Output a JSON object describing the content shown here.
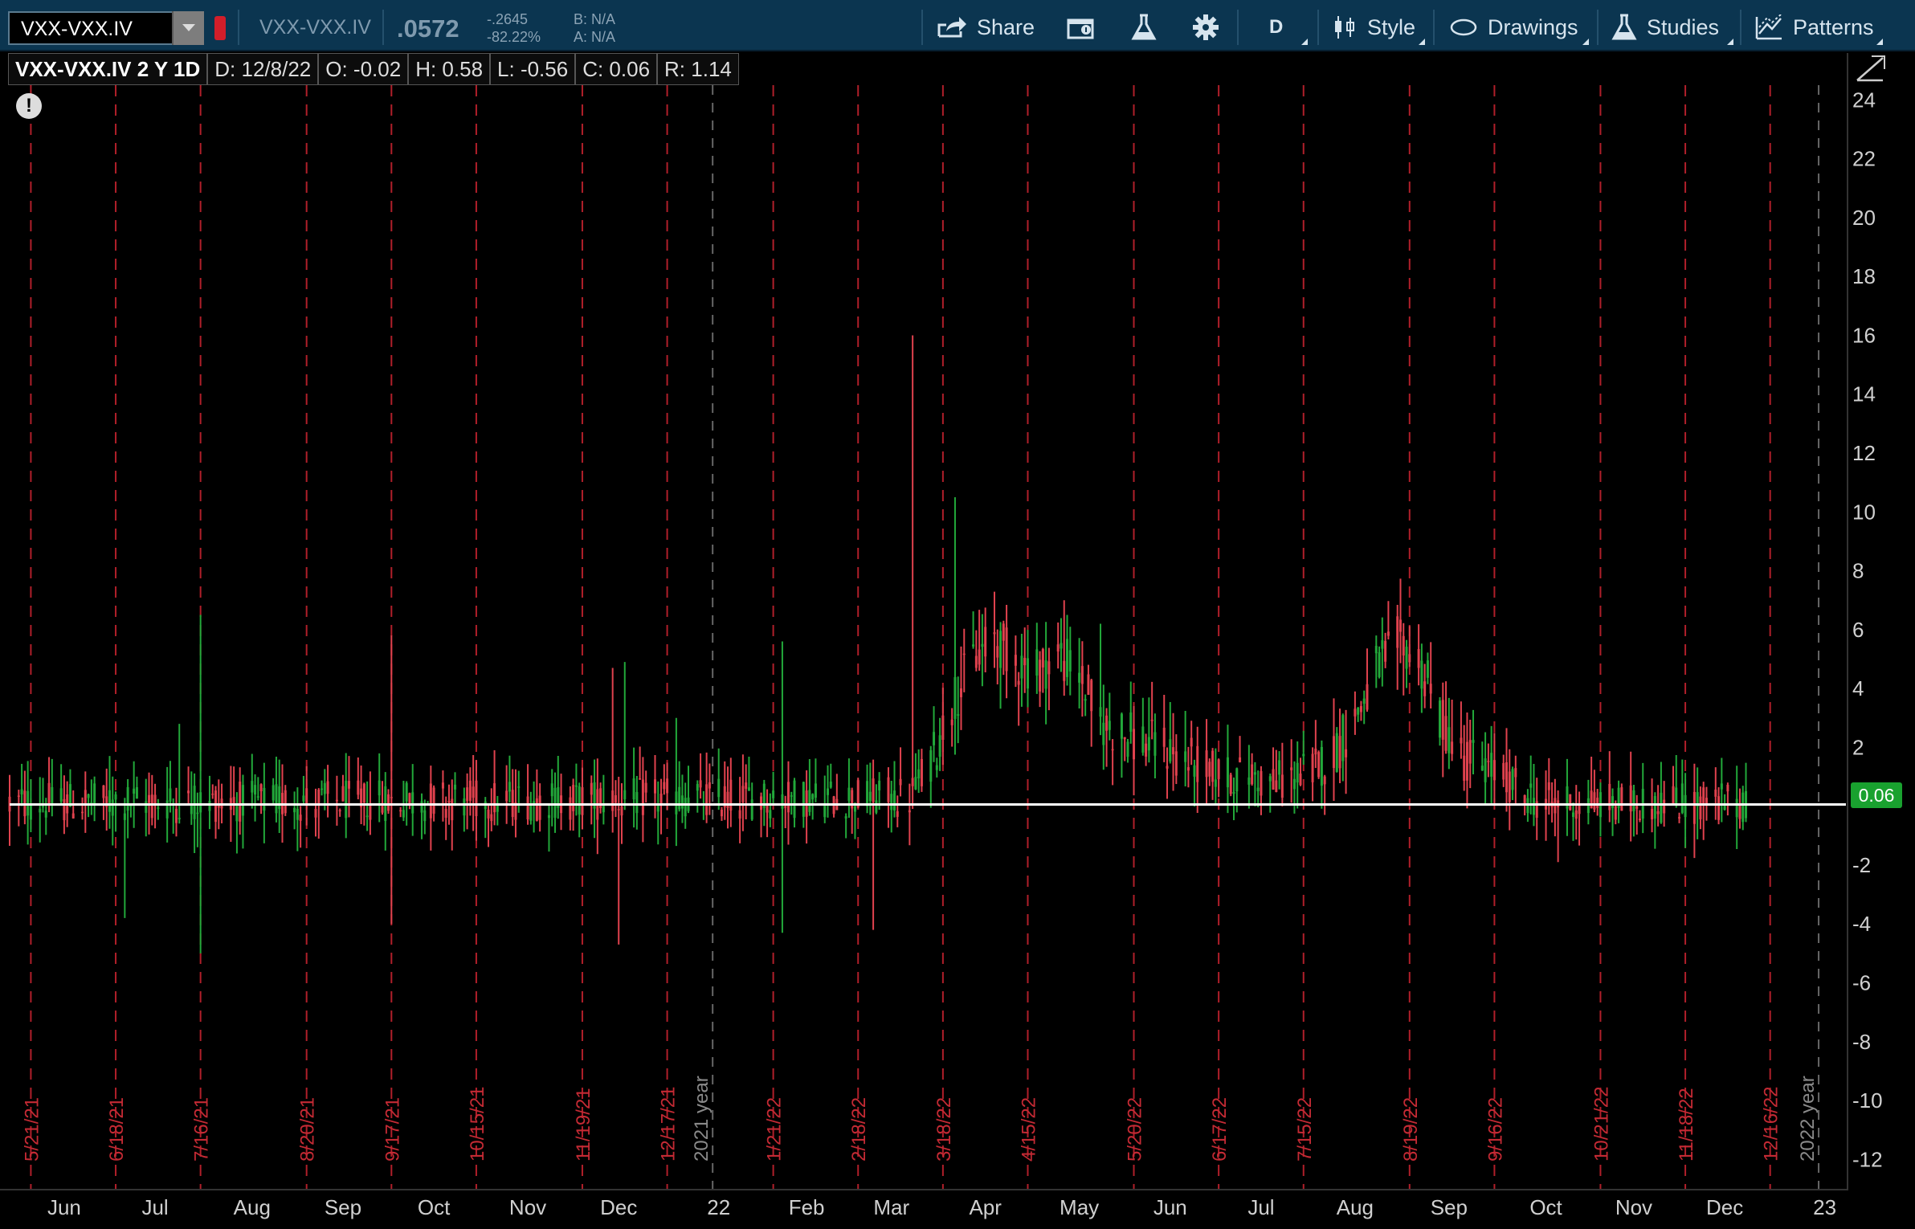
{
  "toolbar": {
    "symbol": "VXX-VXX.IV",
    "symbol_display": "VXX-VXX.IV",
    "last": ".0572",
    "net_change": "-.2645",
    "pct_change": "-82.22%",
    "bid": "B: N/A",
    "ask": "A: N/A",
    "share_label": "Share",
    "period_label": "D",
    "style_label": "Style",
    "drawings_label": "Drawings",
    "studies_label": "Studies",
    "patterns_label": "Patterns",
    "icons": [
      "share-icon",
      "calendar-info-icon",
      "flask-icon",
      "gear-icon",
      "candles-icon",
      "ellipse-icon",
      "flask-icon",
      "patterns-icon"
    ]
  },
  "ohlc": {
    "title": "VXX-VXX.IV 2 Y 1D",
    "date": "D: 12/8/22",
    "open": "O: -0.02",
    "high": "H: 0.58",
    "low": "L: -0.56",
    "close": "C: 0.06",
    "range": "R: 1.14"
  },
  "colors": {
    "up": "#22a83a",
    "down": "#e0424e",
    "grid_red": "#b01f2a",
    "grid_gray": "#666666",
    "price_line": "#ffffff",
    "tag": "#19a12f"
  },
  "chart_data": {
    "type": "candlestick",
    "ylim": [
      -13,
      24.5
    ],
    "yticks": [
      24,
      22,
      20,
      18,
      16,
      14,
      12,
      10,
      8,
      6,
      4,
      2,
      0,
      -2,
      -4,
      -6,
      -8,
      -10,
      -12
    ],
    "ytick_labels": [
      "24",
      "22",
      "20",
      "18",
      "16",
      "14",
      "12",
      "10",
      "8",
      "6",
      "4",
      "2",
      "",
      "-2",
      "-4",
      "-6",
      "-8",
      "-10",
      "-12"
    ],
    "last_price": 0.06,
    "last_price_label": "0.06",
    "xlim": [
      "2021-05-14",
      "2023-01-10"
    ],
    "month_labels": [
      {
        "date": "2021-06-01",
        "label": "Jun"
      },
      {
        "date": "2021-07-01",
        "label": "Jul"
      },
      {
        "date": "2021-08-02",
        "label": "Aug"
      },
      {
        "date": "2021-09-01",
        "label": "Sep"
      },
      {
        "date": "2021-10-01",
        "label": "Oct"
      },
      {
        "date": "2021-11-01",
        "label": "Nov"
      },
      {
        "date": "2021-12-01",
        "label": "Dec"
      },
      {
        "date": "2022-01-03",
        "label": "22"
      },
      {
        "date": "2022-02-01",
        "label": "Feb"
      },
      {
        "date": "2022-03-01",
        "label": "Mar"
      },
      {
        "date": "2022-04-01",
        "label": "Apr"
      },
      {
        "date": "2022-05-02",
        "label": "May"
      },
      {
        "date": "2022-06-01",
        "label": "Jun"
      },
      {
        "date": "2022-07-01",
        "label": "Jul"
      },
      {
        "date": "2022-08-01",
        "label": "Aug"
      },
      {
        "date": "2022-09-01",
        "label": "Sep"
      },
      {
        "date": "2022-10-03",
        "label": "Oct"
      },
      {
        "date": "2022-11-01",
        "label": "Nov"
      },
      {
        "date": "2022-12-01",
        "label": "Dec"
      },
      {
        "date": "2023-01-03",
        "label": "23"
      }
    ],
    "expiration_lines": [
      {
        "date": "2021-05-21",
        "label": "5/21/21"
      },
      {
        "date": "2021-06-18",
        "label": "6/18/21"
      },
      {
        "date": "2021-07-16",
        "label": "7/16/21"
      },
      {
        "date": "2021-08-20",
        "label": "8/20/21"
      },
      {
        "date": "2021-09-17",
        "label": "9/17/21"
      },
      {
        "date": "2021-10-15",
        "label": "10/15/21"
      },
      {
        "date": "2021-11-19",
        "label": "11/19/21"
      },
      {
        "date": "2021-12-17",
        "label": "12/17/21"
      },
      {
        "date": "2022-01-21",
        "label": "1/21/22"
      },
      {
        "date": "2022-02-18",
        "label": "2/18/22"
      },
      {
        "date": "2022-03-18",
        "label": "3/18/22"
      },
      {
        "date": "2022-04-15",
        "label": "4/15/22"
      },
      {
        "date": "2022-05-20",
        "label": "5/20/22"
      },
      {
        "date": "2022-06-17",
        "label": "6/17/22"
      },
      {
        "date": "2022-07-15",
        "label": "7/15/22"
      },
      {
        "date": "2022-08-19",
        "label": "8/19/22"
      },
      {
        "date": "2022-09-16",
        "label": "9/16/22"
      },
      {
        "date": "2022-10-21",
        "label": "10/21/22"
      },
      {
        "date": "2022-11-18",
        "label": "11/18/22"
      },
      {
        "date": "2022-12-16",
        "label": "12/16/22"
      }
    ],
    "year_lines": [
      {
        "date": "2022-01-01",
        "label": "2021 year"
      },
      {
        "date": "2023-01-01",
        "label": "2022 year"
      }
    ],
    "baseline_path": [
      {
        "date": "2021-05-14",
        "value": 0.1
      },
      {
        "date": "2022-03-07",
        "value": 0.3
      },
      {
        "date": "2022-03-14",
        "value": 1.5
      },
      {
        "date": "2022-03-21",
        "value": 3.5
      },
      {
        "date": "2022-03-28",
        "value": 5.0
      },
      {
        "date": "2022-04-04",
        "value": 5.7
      },
      {
        "date": "2022-04-11",
        "value": 5.0
      },
      {
        "date": "2022-04-18",
        "value": 4.6
      },
      {
        "date": "2022-04-25",
        "value": 5.2
      },
      {
        "date": "2022-05-02",
        "value": 4.5
      },
      {
        "date": "2022-05-09",
        "value": 2.8
      },
      {
        "date": "2022-05-16",
        "value": 2.5
      },
      {
        "date": "2022-05-23",
        "value": 2.2
      },
      {
        "date": "2022-05-30",
        "value": 2.0
      },
      {
        "date": "2022-06-06",
        "value": 1.6
      },
      {
        "date": "2022-06-13",
        "value": 1.3
      },
      {
        "date": "2022-06-20",
        "value": 1.0
      },
      {
        "date": "2022-06-27",
        "value": 1.1
      },
      {
        "date": "2022-07-04",
        "value": 0.8
      },
      {
        "date": "2022-07-11",
        "value": 1.0
      },
      {
        "date": "2022-07-18",
        "value": 1.3
      },
      {
        "date": "2022-07-25",
        "value": 1.8
      },
      {
        "date": "2022-08-01",
        "value": 3.0
      },
      {
        "date": "2022-08-08",
        "value": 4.6
      },
      {
        "date": "2022-08-15",
        "value": 5.6
      },
      {
        "date": "2022-08-22",
        "value": 5.0
      },
      {
        "date": "2022-08-29",
        "value": 3.0
      },
      {
        "date": "2022-09-05",
        "value": 1.8
      },
      {
        "date": "2022-09-12",
        "value": 1.4
      },
      {
        "date": "2022-09-19",
        "value": 1.0
      },
      {
        "date": "2022-09-26",
        "value": 0.4
      },
      {
        "date": "2022-10-03",
        "value": 0.1
      },
      {
        "date": "2022-12-08",
        "value": 0.1
      }
    ],
    "spikes": [
      {
        "date": "2021-07-09",
        "value": 2.8
      },
      {
        "date": "2021-07-16",
        "value": 6.5
      },
      {
        "date": "2021-07-16",
        "value": -5.0
      },
      {
        "date": "2021-09-17",
        "value": 5.8
      },
      {
        "date": "2021-09-17",
        "value": -4.0
      },
      {
        "date": "2021-06-21",
        "value": -3.8
      },
      {
        "date": "2021-11-29",
        "value": 4.7
      },
      {
        "date": "2021-12-01",
        "value": -4.7
      },
      {
        "date": "2021-12-03",
        "value": 4.9
      },
      {
        "date": "2021-12-20",
        "value": 3.0
      },
      {
        "date": "2022-01-24",
        "value": 5.6
      },
      {
        "date": "2022-01-24",
        "value": -4.3
      },
      {
        "date": "2022-02-23",
        "value": -4.2
      },
      {
        "date": "2022-03-08",
        "value": 16.0
      },
      {
        "date": "2022-03-22",
        "value": 10.5
      },
      {
        "date": "2022-04-04",
        "value": 7.2
      },
      {
        "date": "2022-04-27",
        "value": 7.0
      },
      {
        "date": "2022-05-09",
        "value": 6.2
      },
      {
        "date": "2022-08-17",
        "value": 6.2
      },
      {
        "date": "2022-09-08",
        "value": 2.6
      },
      {
        "date": "2022-10-07",
        "value": -1.9
      }
    ]
  }
}
